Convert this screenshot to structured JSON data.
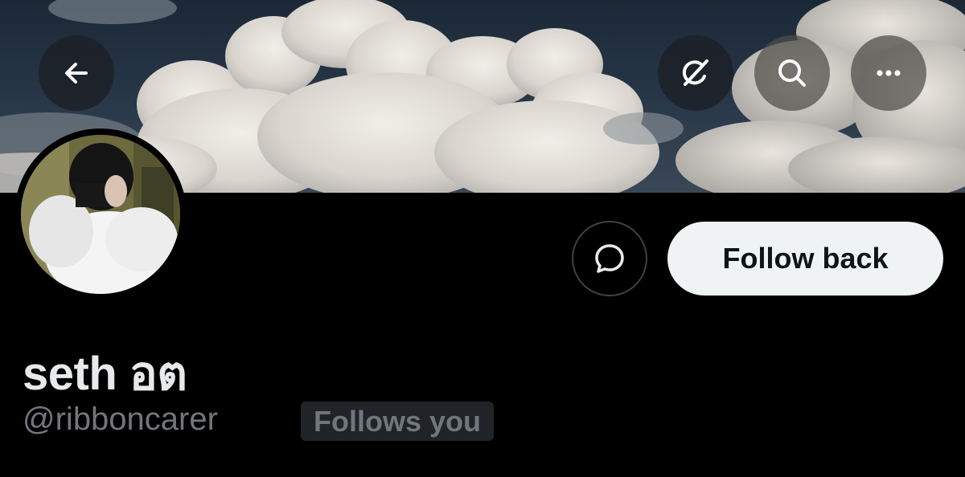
{
  "header": {
    "back_icon": "arrow-left-icon",
    "grok_icon": "grok-icon",
    "search_icon": "search-icon",
    "more_icon": "more-horizontal-icon"
  },
  "profile": {
    "display_name": "seth อต",
    "handle": "@ribboncarer",
    "follows_you_label": "Follows you"
  },
  "actions": {
    "message_icon": "message-bubble-icon",
    "follow_label": "Follow back"
  },
  "colors": {
    "background": "#000000",
    "follow_button_bg": "#eff3f4",
    "follow_button_text": "#0f1419",
    "name_text": "#e7e9ea",
    "secondary_text": "#71767b",
    "badge_bg": "#202327"
  }
}
